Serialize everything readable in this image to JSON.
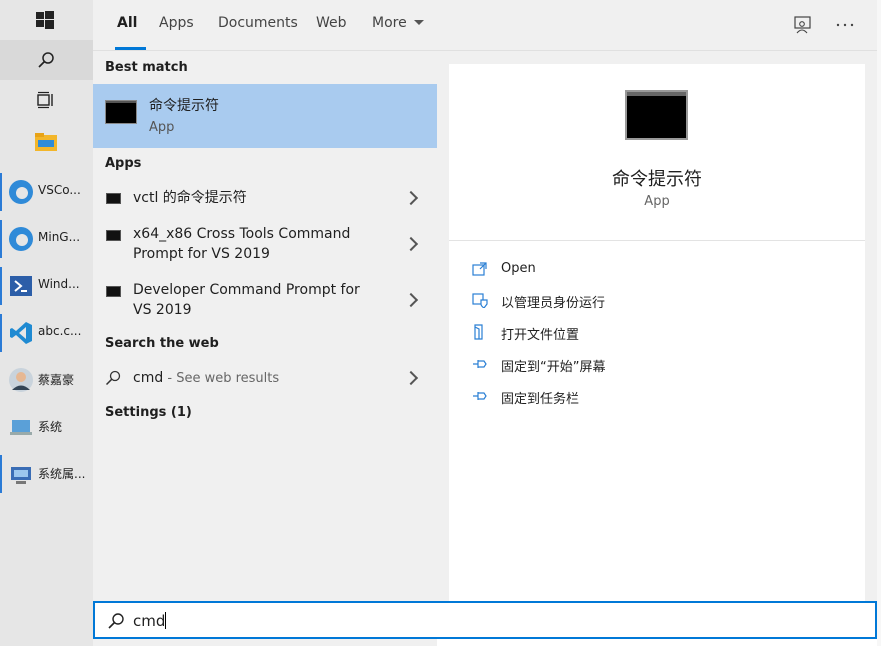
{
  "tabs": [
    {
      "label": "All",
      "active": true
    },
    {
      "label": "Apps"
    },
    {
      "label": "Documents"
    },
    {
      "label": "Web"
    },
    {
      "label": "More"
    }
  ],
  "sections": {
    "best_match": "Best match",
    "apps": "Apps",
    "search_web": "Search the web",
    "settings": "Settings (1)"
  },
  "best_match": {
    "name": "命令提示符",
    "kind": "App"
  },
  "apps": [
    {
      "lines": [
        "vctl 的命令提示符"
      ]
    },
    {
      "lines": [
        "x64_x86 Cross Tools Command",
        "Prompt for VS 2019"
      ]
    },
    {
      "lines": [
        "Developer Command Prompt for",
        "VS 2019"
      ]
    }
  ],
  "web": {
    "query": "cmd",
    "suffix": " - See web results"
  },
  "detail": {
    "title": "命令提示符",
    "kind": "App",
    "actions": [
      {
        "label": "Open",
        "icon": "open-icon"
      },
      {
        "label": "以管理员身份运行",
        "icon": "shield-icon"
      },
      {
        "label": "打开文件位置",
        "icon": "file-location-icon"
      },
      {
        "label": "固定到“开始”屏幕",
        "icon": "pin-icon"
      },
      {
        "label": "固定到任务栏",
        "icon": "pin-icon"
      }
    ]
  },
  "taskbar": [
    {
      "label": "VSCo...",
      "icon": "edge-icon"
    },
    {
      "label": "MinG...",
      "icon": "edge-icon"
    },
    {
      "label": "Wind...",
      "icon": "powershell-icon"
    },
    {
      "label": "abc.c...",
      "icon": "vscode-icon"
    },
    {
      "label": "蔡嘉豪",
      "icon": "avatar-icon"
    },
    {
      "label": "系统",
      "icon": "system-icon"
    },
    {
      "label": "系统属...",
      "icon": "system-properties-icon"
    }
  ],
  "search": {
    "value": "cmd"
  },
  "colors": {
    "accent": "#0078d7",
    "selection": "#a9cbef",
    "panel": "#f0f0f0"
  }
}
